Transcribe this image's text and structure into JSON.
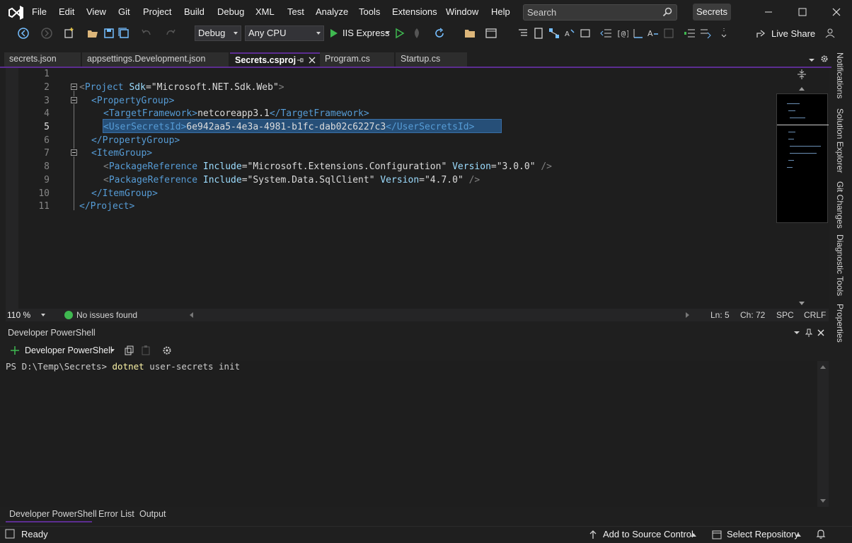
{
  "menu": [
    "File",
    "Edit",
    "View",
    "Git",
    "Project",
    "Build",
    "Debug",
    "XML",
    "Test",
    "Analyze",
    "Tools",
    "Extensions",
    "Window",
    "Help"
  ],
  "search": {
    "placeholder": "Search"
  },
  "solution_name": "Secrets",
  "toolbar": {
    "config": "Debug",
    "platform": "Any CPU",
    "run_target": "IIS Express",
    "live_share": "Live Share"
  },
  "tabs": [
    {
      "label": "secrets.json",
      "active": false
    },
    {
      "label": "appsettings.Development.json",
      "active": false
    },
    {
      "label": "Secrets.csproj",
      "active": true
    },
    {
      "label": "Program.cs",
      "active": false
    },
    {
      "label": "Startup.cs",
      "active": false
    }
  ],
  "editor": {
    "line_numbers": [
      "1",
      "2",
      "3",
      "4",
      "5",
      "6",
      "7",
      "8",
      "9",
      "10",
      "11"
    ],
    "current_line": "5",
    "lines": {
      "l2": {
        "lt": "<",
        "tag": "Project",
        "attr": " Sdk",
        "eq": "=",
        "val": "\"Microsoft.NET.Sdk.Web\"",
        "gt": ">"
      },
      "l3": {
        "tag": "<PropertyGroup>"
      },
      "l4": {
        "open": "<TargetFramework>",
        "text": "netcoreapp3.1",
        "close": "</TargetFramework>"
      },
      "l5": {
        "open": "<UserSecretsId>",
        "text": "6e942aa5-4e3a-4981-b1fc-dab02c6227c3",
        "close": "</UserSecretsId>"
      },
      "l6": {
        "tag": "</PropertyGroup>"
      },
      "l7": {
        "tag": "<ItemGroup>"
      },
      "l8": {
        "lt": "<",
        "tag": "PackageReference",
        "attr1": " Include",
        "eq1": "=",
        "val1": "\"Microsoft.Extensions.Configuration\"",
        "attr2": " Version",
        "eq2": "=",
        "val2": "\"3.0.0\"",
        "end": " />"
      },
      "l9": {
        "lt": "<",
        "tag": "PackageReference",
        "attr1": " Include",
        "eq1": "=",
        "val1": "\"System.Data.SqlClient\"",
        "attr2": " Version",
        "eq2": "=",
        "val2": "\"4.7.0\"",
        "end": " />"
      },
      "l10": {
        "tag": "</ItemGroup>"
      },
      "l11": {
        "tag": "</Project>"
      }
    }
  },
  "editor_status": {
    "zoom": "110 %",
    "issues": "No issues found",
    "line": "Ln: 5",
    "col": "Ch: 72",
    "whitespace": "SPC",
    "line_ending": "CRLF"
  },
  "right_rail": [
    "Notifications",
    "Solution Explorer",
    "Git Changes",
    "Diagnostic Tools",
    "Properties"
  ],
  "panel": {
    "title": "Developer PowerShell",
    "profile": "Developer PowerShell",
    "prompt": "PS D:\\Temp\\Secrets> ",
    "command": "dotnet",
    "args": " user-secrets init",
    "tabs": [
      "Developer PowerShell",
      "Error List",
      "Output"
    ]
  },
  "statusbar": {
    "state": "Ready",
    "source_control": "Add to Source Control",
    "repository": "Select Repository"
  }
}
